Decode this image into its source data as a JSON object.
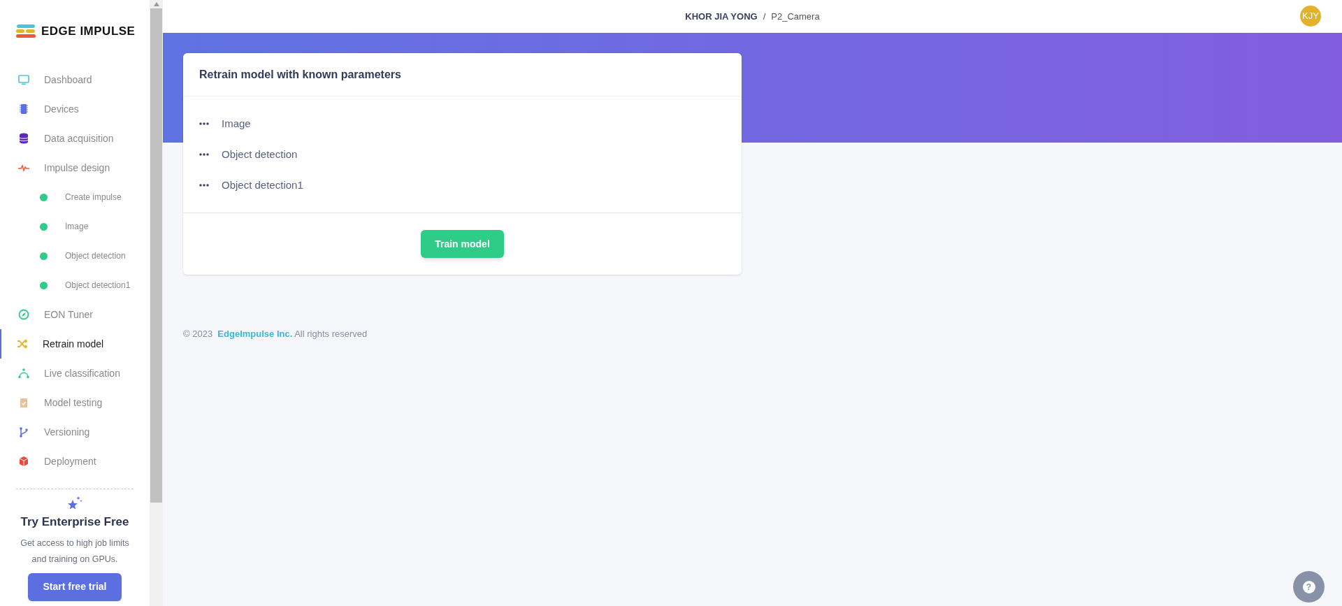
{
  "logo": {
    "text": "EDGE IMPULSE"
  },
  "sidebar": {
    "items": [
      {
        "label": "Dashboard",
        "selected": false
      },
      {
        "label": "Devices",
        "selected": false
      },
      {
        "label": "Data acquisition",
        "selected": false
      },
      {
        "label": "Impulse design",
        "selected": false,
        "children": [
          {
            "label": "Create impulse",
            "color": "#2ecc87"
          },
          {
            "label": "Image",
            "color": "#2ecc87"
          },
          {
            "label": "Object detection",
            "color": "#2ecc87"
          },
          {
            "label": "Object detection1",
            "color": "#2ecc87"
          }
        ]
      },
      {
        "label": "EON Tuner",
        "selected": false
      },
      {
        "label": "Retrain model",
        "selected": true
      },
      {
        "label": "Live classification",
        "selected": false
      },
      {
        "label": "Model testing",
        "selected": false
      },
      {
        "label": "Versioning",
        "selected": false
      },
      {
        "label": "Deployment",
        "selected": false
      }
    ]
  },
  "promo": {
    "title": "Try Enterprise Free",
    "text": "Get access to high job limits and training on GPUs.",
    "button": "Start free trial"
  },
  "header": {
    "user": "KHOR JIA YONG",
    "separator": "/",
    "project": "P2_Camera",
    "avatar": "KJY"
  },
  "card": {
    "title": "Retrain model with known parameters",
    "blocks": [
      "Image",
      "Object detection",
      "Object detection1"
    ],
    "button": "Train model"
  },
  "footer": {
    "copyright": "© 2023",
    "company": "EdgeImpulse Inc.",
    "rights": "All rights reserved"
  },
  "help": {
    "icon": "?"
  }
}
